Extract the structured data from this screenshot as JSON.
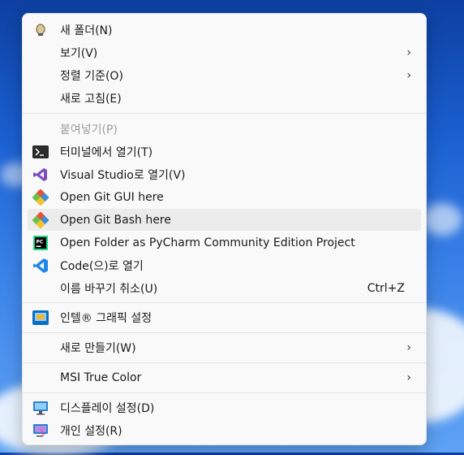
{
  "menu": {
    "items": [
      {
        "label": "새 폴더(N)",
        "icon": "paint-bucket-icon"
      },
      {
        "label": "보기(V)",
        "arrow": "›"
      },
      {
        "label": "정렬 기준(O)",
        "arrow": "›"
      },
      {
        "label": "새로 고침(E)"
      },
      {
        "label": "붙여넣기(P)"
      },
      {
        "label": "터미널에서 열기(T)",
        "icon": "terminal-icon"
      },
      {
        "label": "Visual Studio로 열기(V)",
        "icon": "visual-studio-icon"
      },
      {
        "label": "Open Git GUI here",
        "icon": "git-gui-icon"
      },
      {
        "label": "Open Git Bash here",
        "icon": "git-bash-icon"
      },
      {
        "label": "Open Folder as PyCharm Community Edition Project",
        "icon": "pycharm-icon"
      },
      {
        "label": "Code(으)로 열기",
        "icon": "vscode-icon"
      },
      {
        "label": "이름 바꾸기 취소(U)",
        "shortcut": "Ctrl+Z"
      },
      {
        "label": "인텔® 그래픽 설정",
        "icon": "intel-graphics-icon"
      },
      {
        "label": "새로 만들기(W)",
        "arrow": "›"
      },
      {
        "label": "MSI True Color",
        "arrow": "›"
      },
      {
        "label": "디스플레이 설정(D)",
        "icon": "display-icon"
      },
      {
        "label": "개인 설정(R)",
        "icon": "personalize-icon"
      }
    ]
  }
}
